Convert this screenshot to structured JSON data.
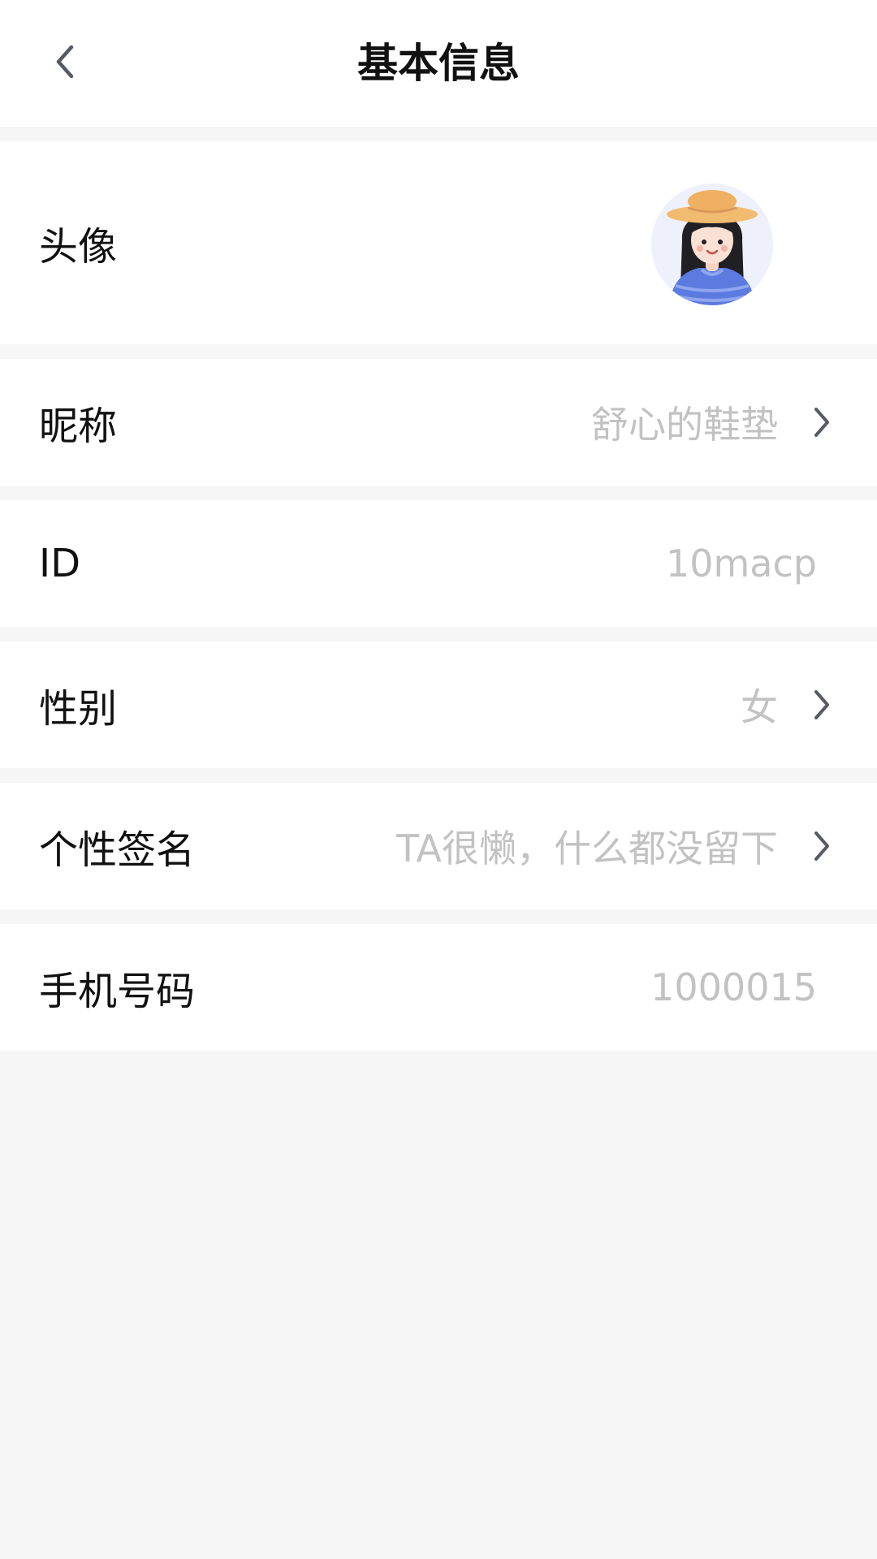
{
  "header": {
    "title": "基本信息",
    "back_icon": "chevron-left-icon"
  },
  "rows": {
    "avatar": {
      "label": "头像"
    },
    "nickname": {
      "label": "昵称",
      "value": "舒心的鞋垫"
    },
    "id": {
      "label": "ID",
      "value": "10macp"
    },
    "gender": {
      "label": "性别",
      "value": "女"
    },
    "signature": {
      "label": "个性签名",
      "value": "TA很懒，什么都没留下"
    },
    "phone": {
      "label": "手机号码",
      "value": "1000015"
    }
  },
  "colors": {
    "background": "#f6f6f6",
    "card": "#ffffff",
    "label_text": "#111111",
    "value_text": "#c2c2c2",
    "chevron": "#555a66"
  }
}
